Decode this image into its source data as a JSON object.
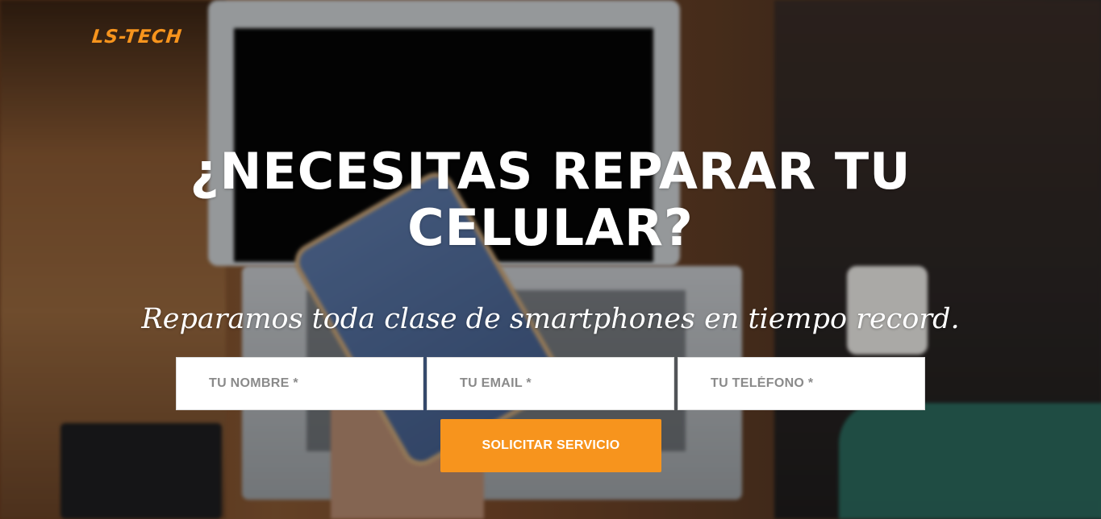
{
  "brand": {
    "logo_text": "LS-TECH",
    "accent_color": "#f7941d"
  },
  "hero": {
    "headline": "¿NECESITAS REPARAR TU CELULAR?",
    "subheadline": "Reparamos toda clase de smartphones en tiempo record."
  },
  "form": {
    "name_placeholder": "TU NOMBRE *",
    "email_placeholder": "TU EMAIL *",
    "phone_placeholder": "TU TELÉFONO *",
    "name_value": "",
    "email_value": "",
    "phone_value": "",
    "submit_label": "SOLICITAR SERVICIO"
  }
}
